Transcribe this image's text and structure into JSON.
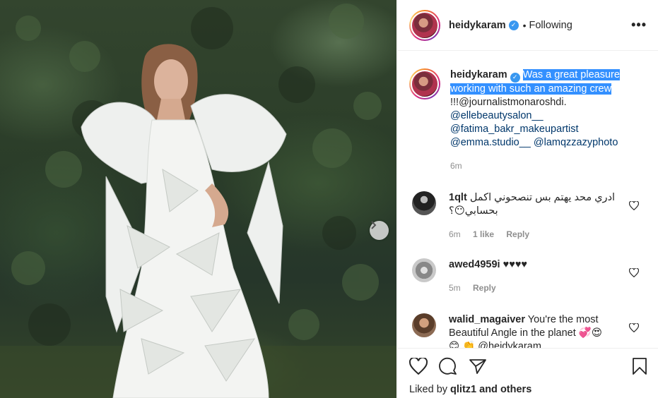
{
  "post": {
    "username": "heidykaram",
    "follow_status": "Following",
    "caption_highlighted": "Was a great pleasure working with such an amazing crew",
    "caption_rest": "!!!@journalistmonaroshdi.",
    "caption_tags": [
      "@ellebeautysalon__",
      "@fatima_bakr_makeupartist",
      "@emma.studio__",
      "@lamqzzazyphoto"
    ],
    "time": "6m"
  },
  "comments": [
    {
      "user": "1qlt",
      "text": "ادري محد يهتم بس تنصحوني اكمل بحسابي😶؟",
      "time": "6m",
      "likes": "1 like",
      "reply": "Reply"
    },
    {
      "user": "awed4959i",
      "text": "♥♥♥♥",
      "time": "5m",
      "reply": "Reply"
    },
    {
      "user": "walid_magaiver",
      "text": "You're the most Beautiful Angle in the planet 💞😍",
      "extra": "😊 👏 @heidykaram"
    }
  ],
  "liked_by": {
    "prefix": "Liked by",
    "user": "qlitz1",
    "suffix": "and others"
  },
  "colors": {
    "highlight": "#3390ff",
    "verified": "#3897f0",
    "link": "#00376b",
    "muted": "#8e8e8e"
  },
  "icons": [
    "more-options-icon",
    "verified-icon",
    "heart-icon",
    "comment-icon",
    "share-icon",
    "bookmark-icon",
    "chevron-right-icon"
  ]
}
